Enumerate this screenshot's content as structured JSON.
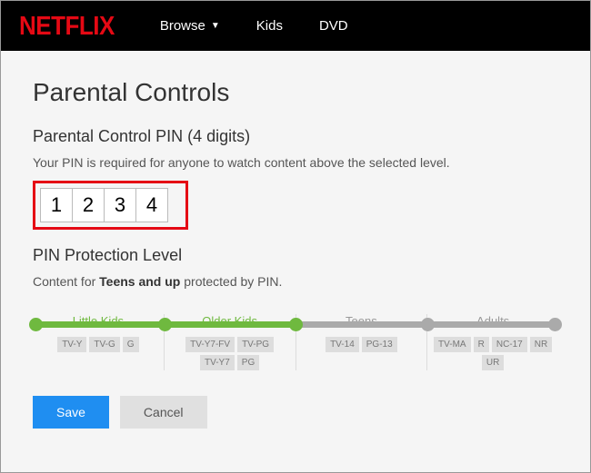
{
  "header": {
    "logo": "NETFLIX",
    "nav": {
      "browse": "Browse",
      "kids": "Kids",
      "dvd": "DVD"
    }
  },
  "page": {
    "title": "Parental Controls",
    "pin_heading": "Parental Control PIN (4 digits)",
    "pin_desc": "Your PIN is required for anyone to watch content above the selected level.",
    "pin": [
      "1",
      "2",
      "3",
      "4"
    ],
    "level_heading": "PIN Protection Level",
    "protection_prefix": "Content for ",
    "protection_bold": "Teens and up",
    "protection_suffix": " protected by PIN."
  },
  "slider": {
    "selected_index": 2,
    "colors": {
      "active": "#6fb93f",
      "inactive": "#aaa"
    },
    "levels": [
      {
        "name": "Little Kids",
        "ratings": [
          "TV-Y",
          "TV-G",
          "G"
        ],
        "active": true
      },
      {
        "name": "Older Kids",
        "ratings": [
          "TV-Y7-FV",
          "TV-PG",
          "TV-Y7",
          "PG"
        ],
        "active": true
      },
      {
        "name": "Teens",
        "ratings": [
          "TV-14",
          "PG-13"
        ],
        "active": false
      },
      {
        "name": "Adults",
        "ratings": [
          "TV-MA",
          "R",
          "NC-17",
          "NR",
          "UR"
        ],
        "active": false
      }
    ]
  },
  "buttons": {
    "save": "Save",
    "cancel": "Cancel"
  }
}
